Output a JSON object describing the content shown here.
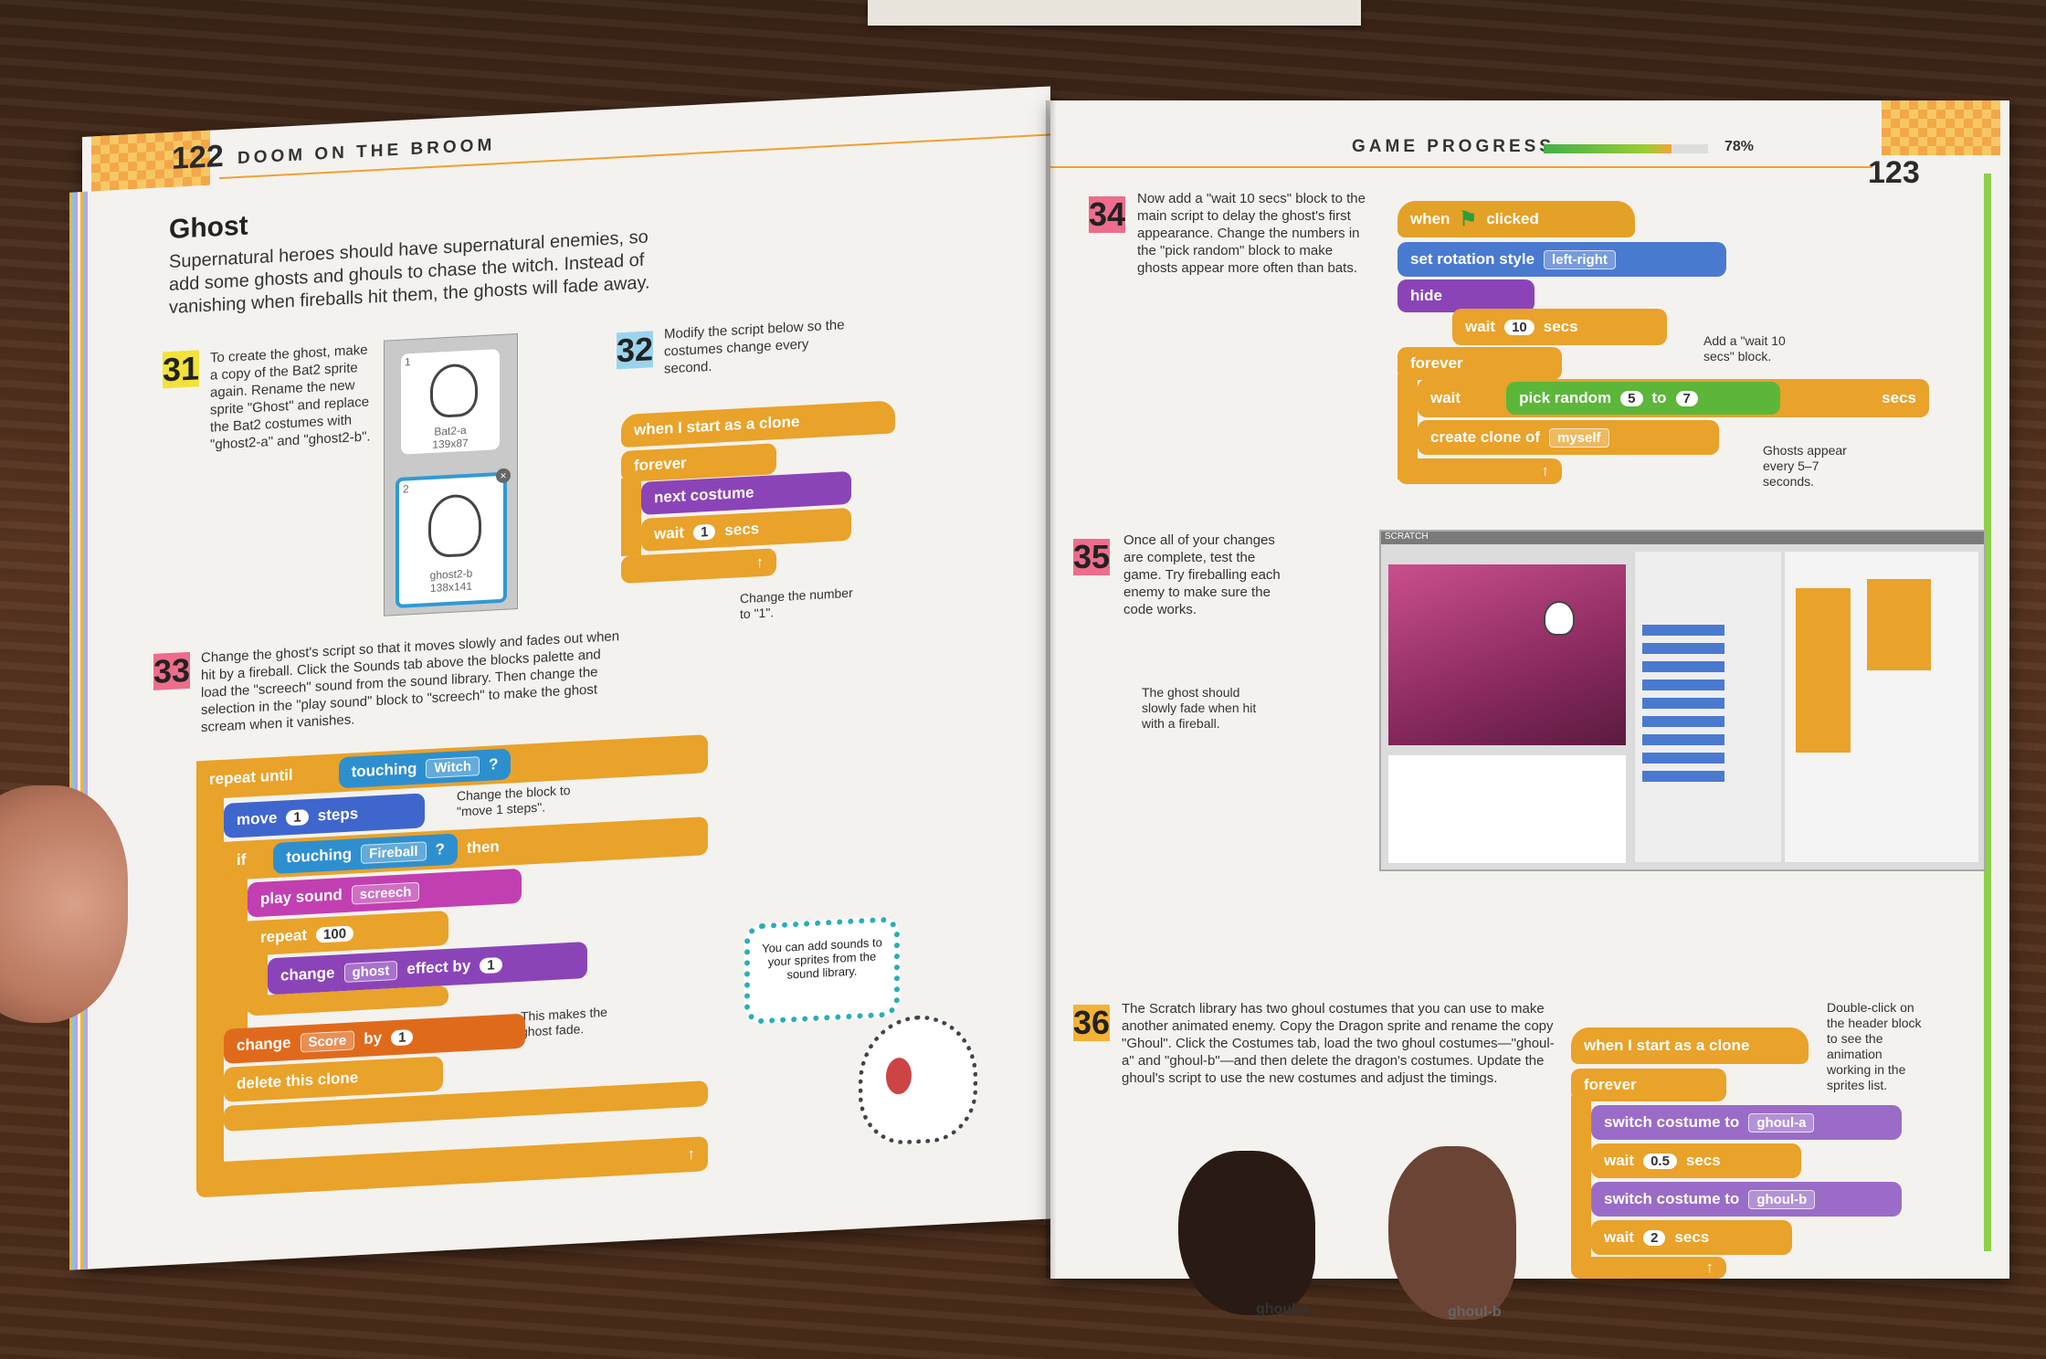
{
  "left_page": {
    "page_number": "122",
    "running_head": "DOOM ON THE BROOM",
    "section_title": "Ghost",
    "intro": "Supernatural heroes should have supernatural enemies, so add some ghosts and ghouls to chase the witch. Instead of vanishing when fireballs hit them, the ghosts will fade away.",
    "step31": {
      "num": "31",
      "text": "To create the ghost, make a copy of the Bat2 sprite again. Rename the new sprite \"Ghost\" and replace the Bat2 costumes with \"ghost2-a\" and \"ghost2-b\".",
      "costumes": [
        {
          "index": "1",
          "name": "Bat2-a",
          "size": "139x87"
        },
        {
          "index": "2",
          "name": "ghost2-b",
          "size": "138x141"
        }
      ]
    },
    "step32": {
      "num": "32",
      "text": "Modify the script below so the costumes change every second.",
      "blocks": {
        "hat": "when I start as a clone",
        "forever": "forever",
        "next": "next costume",
        "wait": "wait",
        "wait_val": "1",
        "secs": "secs"
      },
      "callout": "Change the number to \"1\"."
    },
    "step33": {
      "num": "33",
      "text": "Change the ghost's script so that it moves slowly and fades out when hit by a fireball. Click the Sounds tab above the blocks palette and load the \"screech\" sound from the sound library. Then change the selection in the \"play sound\" block to \"screech\" to make the ghost scream when it vanishes.",
      "blocks": {
        "repeat_until": "repeat until",
        "touching": "touching",
        "witch": "Witch",
        "q": "?",
        "move": "move",
        "move_val": "1",
        "steps": "steps",
        "if": "if",
        "fireball": "Fireball",
        "then": "then",
        "play_sound": "play sound",
        "screech": "screech",
        "repeat": "repeat",
        "repeat_val": "100",
        "change": "change",
        "ghost": "ghost",
        "effect_by": "effect by",
        "effect_val": "1",
        "score": "Score",
        "by": "by",
        "score_val": "1",
        "delete": "delete this clone"
      },
      "callout_move": "Change the block to \"move 1 steps\".",
      "callout_fade": "This makes the ghost fade.",
      "speech": "You can add sounds to your sprites from the sound library."
    }
  },
  "right_page": {
    "page_number": "123",
    "running_head": "GAME PROGRESS",
    "progress_percent": 78,
    "progress_label": "78%",
    "step34": {
      "num": "34",
      "text": "Now add a \"wait 10 secs\" block to the main script to delay the ghost's first appearance. Change the numbers in the \"pick random\" block to make ghosts appear more often than bats.",
      "blocks": {
        "when": "when",
        "clicked": "clicked",
        "rotation": "set rotation style",
        "rotation_val": "left-right",
        "hide": "hide",
        "wait": "wait",
        "wait_val": "10",
        "secs": "secs",
        "forever": "forever",
        "wait2": "wait",
        "pick": "pick random",
        "from": "5",
        "to": "to",
        "to_val": "7",
        "secs2": "secs",
        "create": "create clone of",
        "myself": "myself"
      },
      "callout_wait": "Add a \"wait 10 secs\" block.",
      "callout_ghosts": "Ghosts appear every 5–7 seconds."
    },
    "step35": {
      "num": "35",
      "text": "Once all of your changes are complete, test the game. Try fireballing each enemy to make sure the code works.",
      "callout": "The ghost should slowly fade when hit with a fireball.",
      "app_name": "SCRATCH"
    },
    "step36": {
      "num": "36",
      "text": "The Scratch library has two ghoul costumes that you can use to make another animated enemy. Copy the Dragon sprite and rename the copy \"Ghoul\". Click the Costumes tab, load the two ghoul costumes—\"ghoul-a\" and \"ghoul-b\"—and then delete the dragon's costumes. Update the ghoul's script to use the new costumes and adjust the timings.",
      "ghoul_a": "ghoul-a",
      "ghoul_b": "ghoul-b",
      "blocks": {
        "hat": "when I start as a clone",
        "forever": "forever",
        "switch1": "switch costume to",
        "switch1_val": "ghoul-a",
        "wait1": "wait",
        "wait1_val": "0.5",
        "secs1": "secs",
        "switch2": "switch costume to",
        "switch2_val": "ghoul-b",
        "wait2": "wait",
        "wait2_val": "2",
        "secs2": "secs"
      },
      "callout": "Double-click on the header block to see the animation working in the sprites list."
    }
  }
}
